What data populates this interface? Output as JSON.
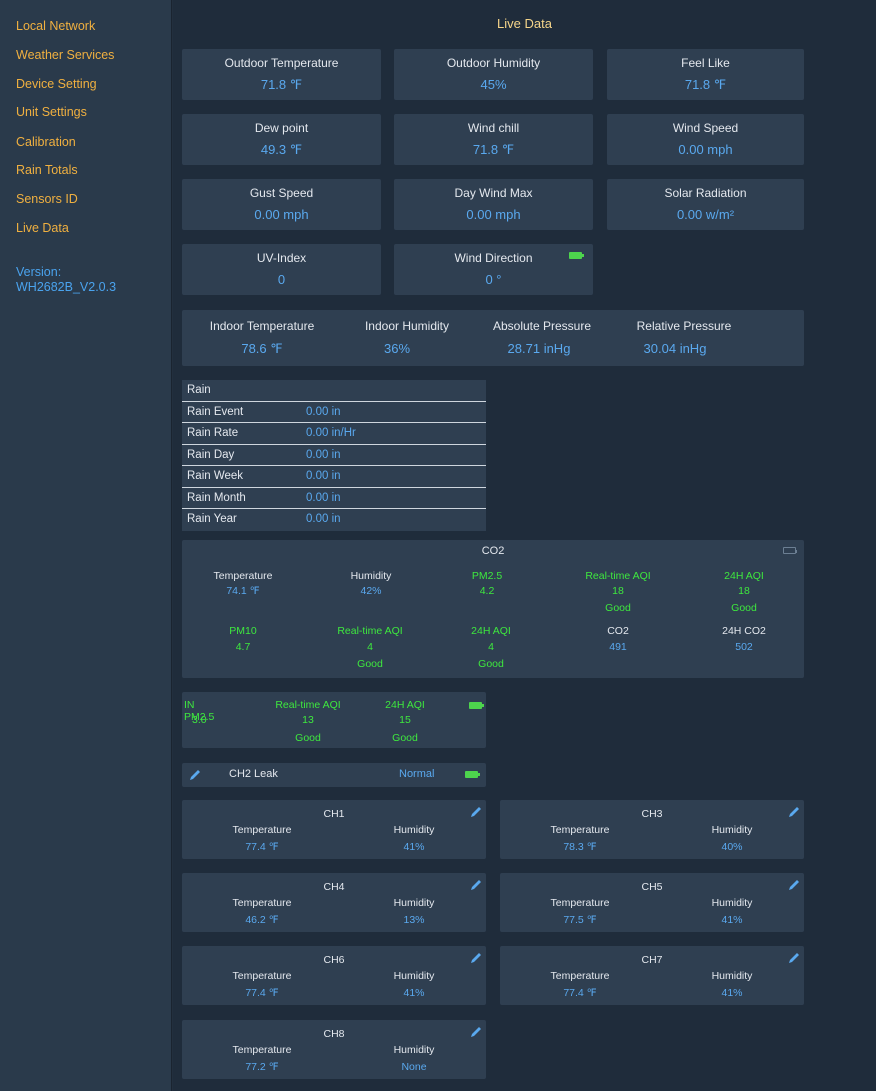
{
  "sidebar": {
    "items": [
      {
        "label": "Local Network"
      },
      {
        "label": "Weather Services"
      },
      {
        "label": "Device Setting"
      },
      {
        "label": "Unit Settings"
      },
      {
        "label": "Calibration"
      },
      {
        "label": "Rain Totals"
      },
      {
        "label": "Sensors ID"
      },
      {
        "label": "Live Data"
      }
    ],
    "version_label": "Version:",
    "version_value": "WH2682B_V2.0.3"
  },
  "page_title": "Live Data",
  "outdoor": [
    {
      "label": "Outdoor Temperature",
      "value": "71.8 ℉"
    },
    {
      "label": "Outdoor Humidity",
      "value": "45%"
    },
    {
      "label": "Feel Like",
      "value": "71.8 ℉"
    },
    {
      "label": "Dew point",
      "value": "49.3 ℉"
    },
    {
      "label": "Wind chill",
      "value": "71.8 ℉"
    },
    {
      "label": "Wind Speed",
      "value": "0.00 mph"
    },
    {
      "label": "Gust Speed",
      "value": "0.00 mph"
    },
    {
      "label": "Day Wind Max",
      "value": "0.00 mph"
    },
    {
      "label": "Solar Radiation",
      "value": "0.00 w/m²"
    },
    {
      "label": "UV-Index",
      "value": "0"
    },
    {
      "label": "Wind Direction",
      "value": "0 °"
    }
  ],
  "indoor": [
    {
      "label": "Indoor Temperature",
      "value": "78.6 ℉"
    },
    {
      "label": "Indoor Humidity",
      "value": "36%"
    },
    {
      "label": "Absolute Pressure",
      "value": "28.71 inHg"
    },
    {
      "label": "Relative Pressure",
      "value": "30.04 inHg"
    }
  ],
  "rain": {
    "header": "Rain",
    "rows": [
      {
        "label": "Rain Event",
        "value": "0.00 in"
      },
      {
        "label": "Rain Rate",
        "value": "0.00 in/Hr"
      },
      {
        "label": "Rain Day",
        "value": "0.00 in"
      },
      {
        "label": "Rain Week",
        "value": "0.00 in"
      },
      {
        "label": "Rain Month",
        "value": "0.00 in"
      },
      {
        "label": "Rain Year",
        "value": "0.00 in"
      }
    ]
  },
  "co2": {
    "title": "CO2",
    "row1": [
      {
        "label": "Temperature",
        "value": "74.1 ℉",
        "status": ""
      },
      {
        "label": "Humidity",
        "value": "42%",
        "status": ""
      },
      {
        "label": "PM2.5",
        "value": "4.2",
        "status": ""
      },
      {
        "label": "Real-time AQI",
        "value": "18",
        "status": "Good"
      },
      {
        "label": "24H AQI",
        "value": "18",
        "status": "Good"
      }
    ],
    "row2": [
      {
        "label": "PM10",
        "value": "4.7",
        "status": ""
      },
      {
        "label": "Real-time AQI",
        "value": "4",
        "status": "Good"
      },
      {
        "label": "24H AQI",
        "value": "4",
        "status": "Good"
      },
      {
        "label": "CO2",
        "value": "491",
        "status": ""
      },
      {
        "label": "24H CO2",
        "value": "502",
        "status": ""
      }
    ]
  },
  "pm25": [
    {
      "label": "IN PM2.5",
      "value": "3.0",
      "status": ""
    },
    {
      "label": "Real-time AQI",
      "value": "13",
      "status": "Good"
    },
    {
      "label": "24H AQI",
      "value": "15",
      "status": "Good"
    }
  ],
  "leak": {
    "name": "CH2 Leak",
    "status": "Normal"
  },
  "channels": [
    {
      "name": "CH1",
      "temp_label": "Temperature",
      "temp": "77.4 ℉",
      "hum_label": "Humidity",
      "hum": "41%"
    },
    {
      "name": "CH3",
      "temp_label": "Temperature",
      "temp": "78.3 ℉",
      "hum_label": "Humidity",
      "hum": "40%"
    },
    {
      "name": "CH4",
      "temp_label": "Temperature",
      "temp": "46.2 ℉",
      "hum_label": "Humidity",
      "hum": "13%"
    },
    {
      "name": "CH5",
      "temp_label": "Temperature",
      "temp": "77.5 ℉",
      "hum_label": "Humidity",
      "hum": "41%"
    },
    {
      "name": "CH6",
      "temp_label": "Temperature",
      "temp": "77.4 ℉",
      "hum_label": "Humidity",
      "hum": "41%"
    },
    {
      "name": "CH7",
      "temp_label": "Temperature",
      "temp": "77.4 ℉",
      "hum_label": "Humidity",
      "hum": "41%"
    },
    {
      "name": "CH8",
      "temp_label": "Temperature",
      "temp": "77.2 ℉",
      "hum_label": "Humidity",
      "hum": "None"
    }
  ],
  "colors": {
    "accent": "#f0b040",
    "value": "#5aa9ef",
    "good": "#3ee83e",
    "panel": "#2f3f51",
    "background": "#1f2c3b"
  },
  "icons": {
    "battery": "battery-icon",
    "edit": "pencil-icon"
  }
}
